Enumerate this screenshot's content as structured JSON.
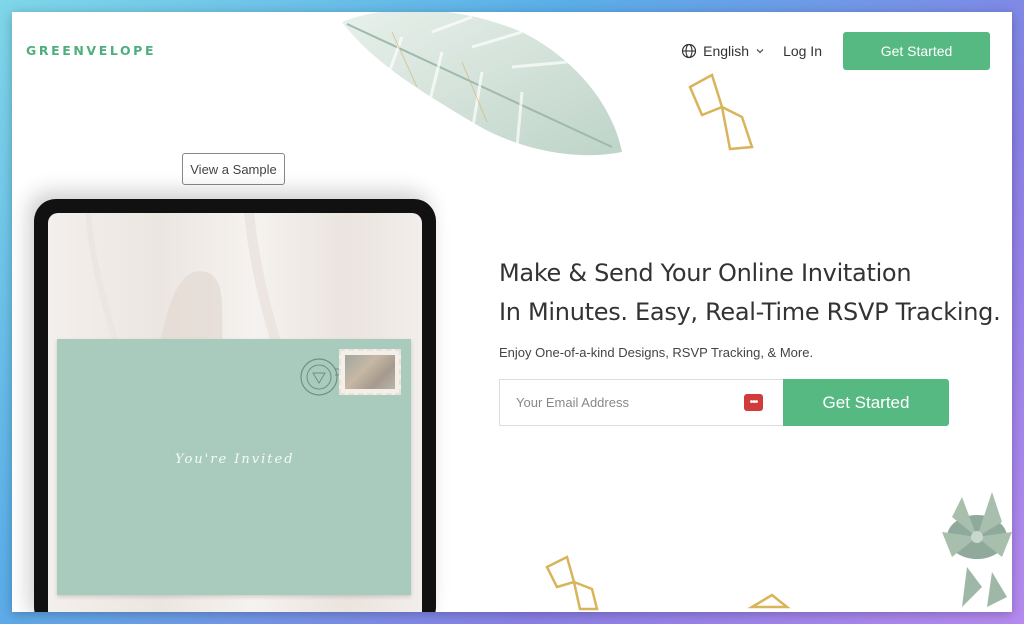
{
  "header": {
    "logo": "GREENVELOPE",
    "language": "English",
    "login_label": "Log In",
    "get_started_label": "Get Started"
  },
  "sample": {
    "button_label": "View a Sample"
  },
  "envelope": {
    "script_text": "You're Invited"
  },
  "hero": {
    "title_line1": "Make & Send Your Online Invitation",
    "title_line2": "In Minutes. Easy, Real-Time RSVP Tracking.",
    "subtitle": "Enjoy One-of-a-kind Designs, RSVP Tracking, & More.",
    "email_placeholder": "Your Email Address",
    "cta_label": "Get Started"
  },
  "icons": {
    "globe": "globe-icon",
    "chevron": "chevron-down-icon",
    "password_manager": "password-manager-icon"
  },
  "colors": {
    "brand_green": "#57b982",
    "logo_green": "#4caf7d",
    "envelope": "#a9cbbd",
    "password_icon_red": "#d23b3b"
  }
}
